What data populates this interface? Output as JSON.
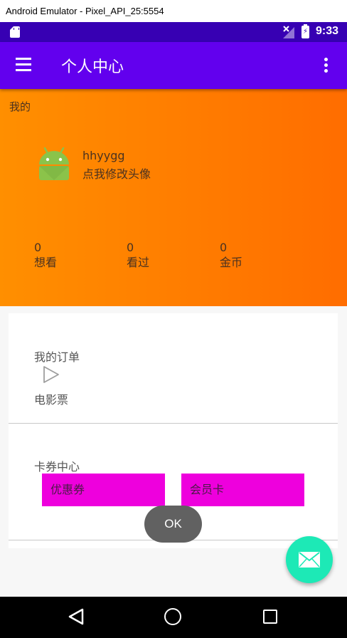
{
  "window": {
    "title": "Android Emulator - Pixel_API_25:5554"
  },
  "status_bar": {
    "time": "9:33"
  },
  "app_bar": {
    "title": "个人中心"
  },
  "profile": {
    "section_title": "我的",
    "username": "hhyygg",
    "edit_avatar": "点我修改头像",
    "stats": [
      {
        "value": "0",
        "label": "想看"
      },
      {
        "value": "0",
        "label": "看过"
      },
      {
        "value": "0",
        "label": "金币"
      }
    ]
  },
  "orders": {
    "title": "我的订单",
    "movie_ticket": "电影票"
  },
  "cards_center": {
    "title": "卡券中心",
    "coupon_label": "优惠券",
    "membership_label": "会员卡"
  },
  "toast": {
    "text": "OK"
  },
  "colors": {
    "status_bar": "#3700b3",
    "app_bar": "#6200ee",
    "profile_gradient_start": "#ff8f00",
    "profile_gradient_end": "#ff6d00",
    "coupon_button": "#ee00dd",
    "fab": "#1de9b6"
  },
  "icons": {
    "fab": "mail-icon",
    "menu": "menu-icon",
    "overflow": "overflow-icon",
    "order": "play-icon"
  }
}
